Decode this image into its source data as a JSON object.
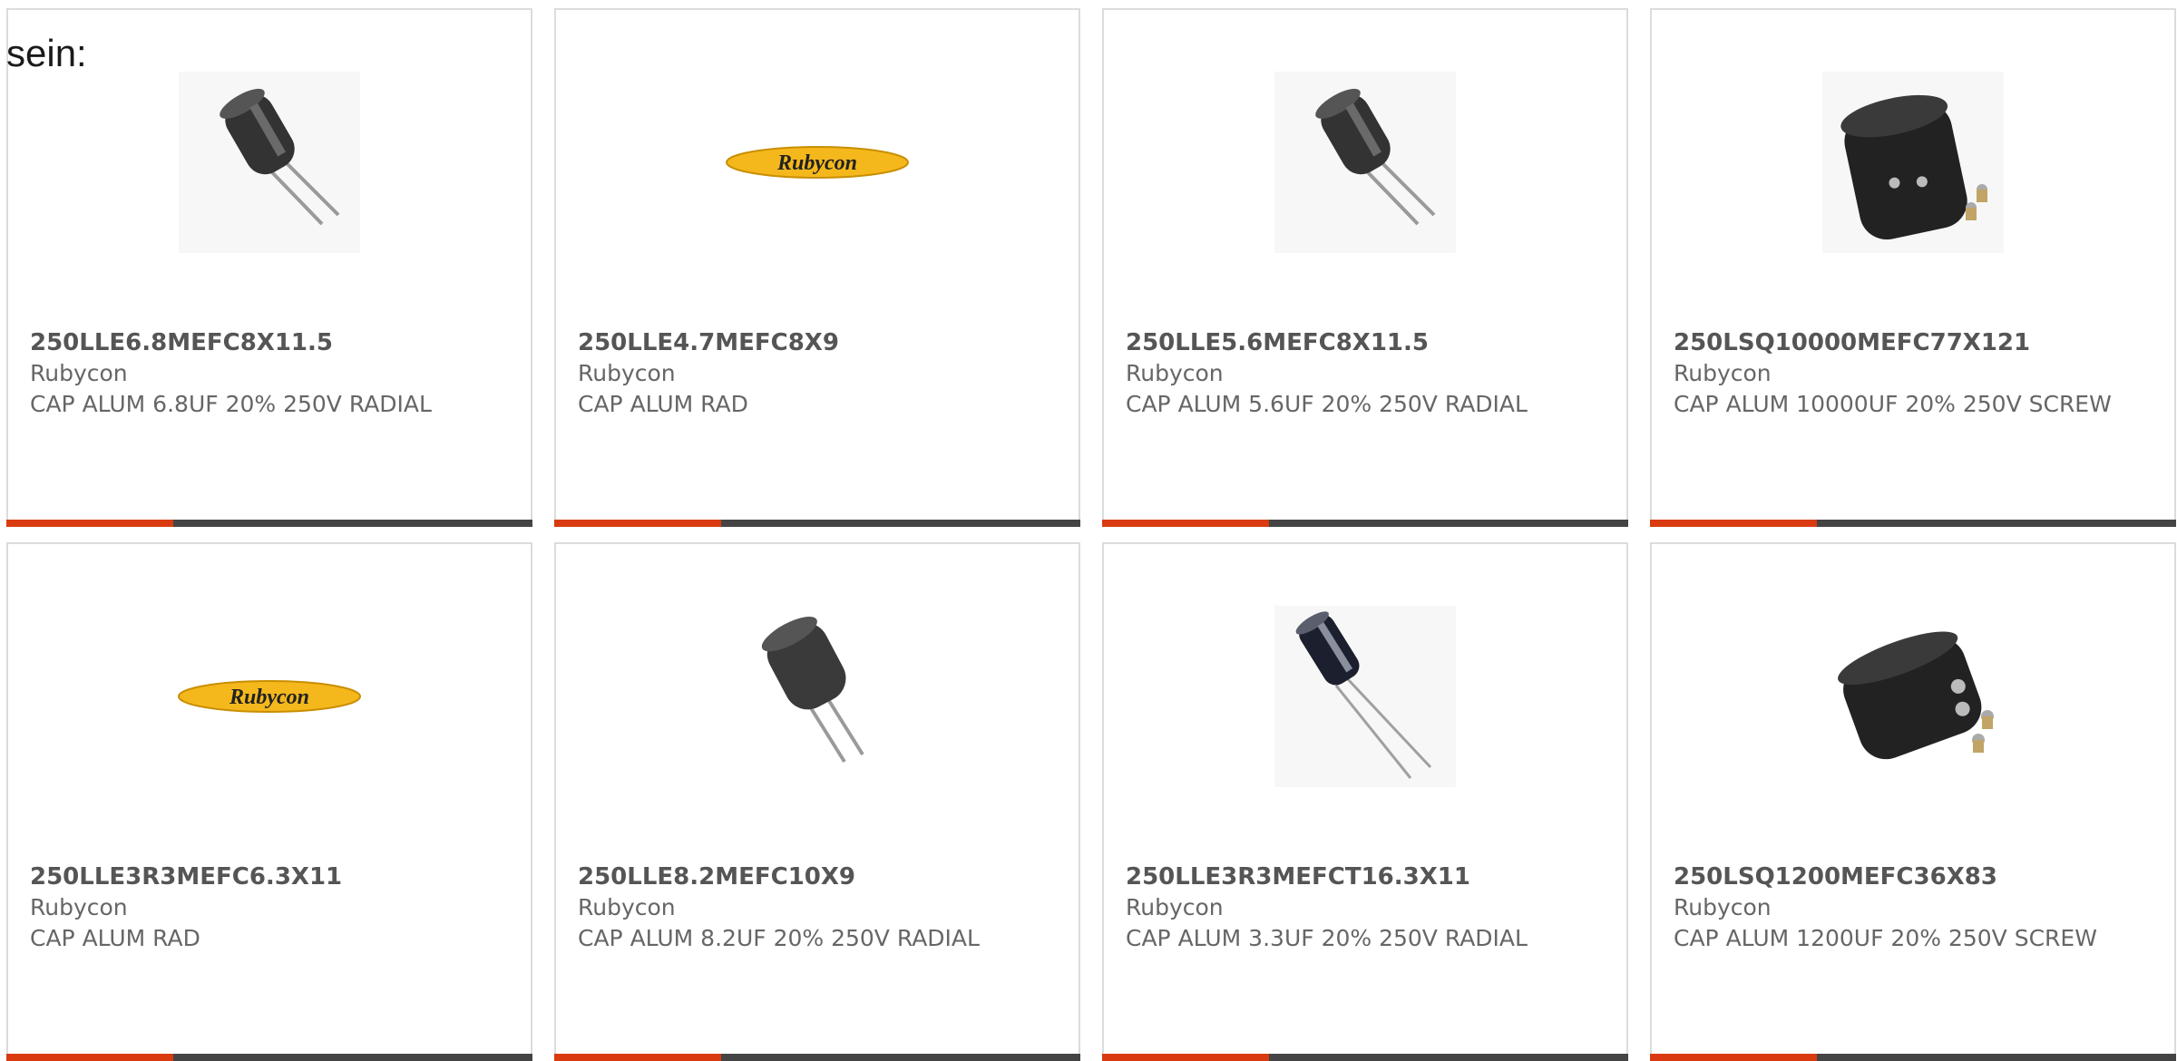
{
  "page": {
    "lead_text": "sein:",
    "accent_color": "#d93a10",
    "bar_color": "#444444"
  },
  "products": [
    {
      "part": "250LLE6.8MEFC8X11.5",
      "manufacturer": "Rubycon",
      "description": "CAP ALUM 6.8UF 20% 250V RADIAL",
      "image": "small-capacitor-image"
    },
    {
      "part": "250LLE4.7MEFC8X9",
      "manufacturer": "Rubycon",
      "description": "CAP ALUM RAD",
      "image": "rubycon-logo-image",
      "logo_text": "Rubycon"
    },
    {
      "part": "250LLE5.6MEFC8X11.5",
      "manufacturer": "Rubycon",
      "description": "CAP ALUM 5.6UF 20% 250V RADIAL",
      "image": "small-capacitor-image"
    },
    {
      "part": "250LSQ10000MEFC77X121",
      "manufacturer": "Rubycon",
      "description": "CAP ALUM 10000UF 20% 250V SCREW",
      "image": "screw-capacitor-image"
    },
    {
      "part": "250LLE3R3MEFC6.3X11",
      "manufacturer": "Rubycon",
      "description": "CAP ALUM RAD",
      "image": "rubycon-logo-image",
      "logo_text": "Rubycon"
    },
    {
      "part": "250LLE8.2MEFC10X9",
      "manufacturer": "Rubycon",
      "description": "CAP ALUM 8.2UF 20% 250V RADIAL",
      "image": "small-capacitor-image"
    },
    {
      "part": "250LLE3R3MEFCT16.3X11",
      "manufacturer": "Rubycon",
      "description": "CAP ALUM 3.3UF 20% 250V RADIAL",
      "image": "blue-capacitor-image"
    },
    {
      "part": "250LSQ1200MEFC36X83",
      "manufacturer": "Rubycon",
      "description": "CAP ALUM 1200UF 20% 250V SCREW",
      "image": "screw-capacitor-image"
    }
  ]
}
